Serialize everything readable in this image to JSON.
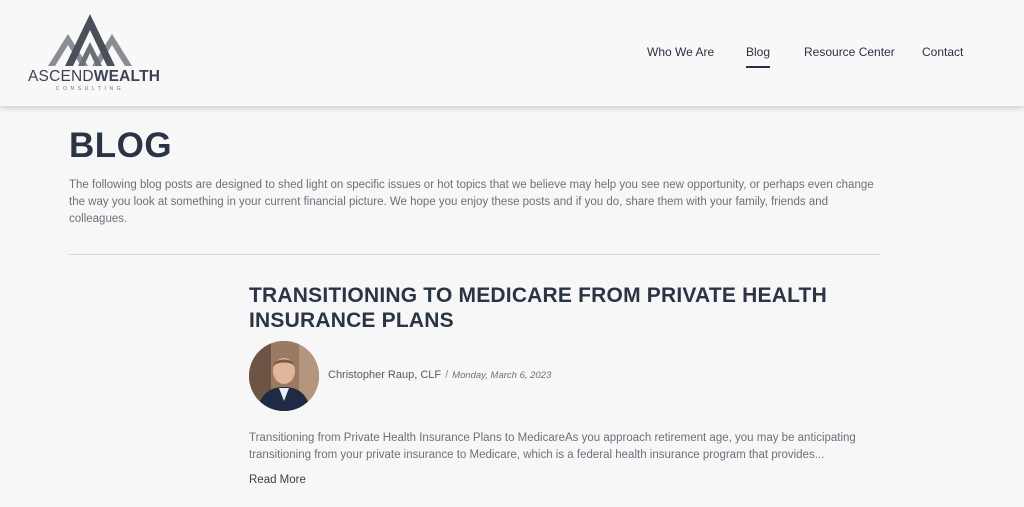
{
  "header": {
    "logo": {
      "word_a": "ASCEND",
      "word_b": "WEALTH",
      "sub": "CONSULTING"
    },
    "nav": [
      {
        "label": "Who We Are",
        "active": false
      },
      {
        "label": "Blog",
        "active": true
      },
      {
        "label": "Resource Center",
        "active": false
      },
      {
        "label": "Contact",
        "active": false
      }
    ]
  },
  "page": {
    "title": "BLOG",
    "intro": "The following blog posts are designed to shed light on specific issues or hot topics that we believe may help you see new opportunity, or perhaps even change the way you look at something in your current financial picture. We hope you enjoy these posts and if you do, share them with your family, friends and colleagues."
  },
  "post": {
    "title": "TRANSITIONING TO MEDICARE FROM PRIVATE HEALTH INSURANCE PLANS",
    "author": "Christopher Raup, CLF",
    "separator": "/",
    "date": "Monday, March 6, 2023",
    "excerpt": "Transitioning from Private Health Insurance Plans to MedicareAs you approach retirement age, you may be anticipating transitioning from your private insurance to Medicare, which is a federal health insurance program that provides...",
    "read_more": "Read More"
  },
  "colors": {
    "heading": "#2b3445",
    "body_text": "#6c7079",
    "logo_gray": "#8a8d93",
    "logo_dark": "#4a4f5a"
  }
}
